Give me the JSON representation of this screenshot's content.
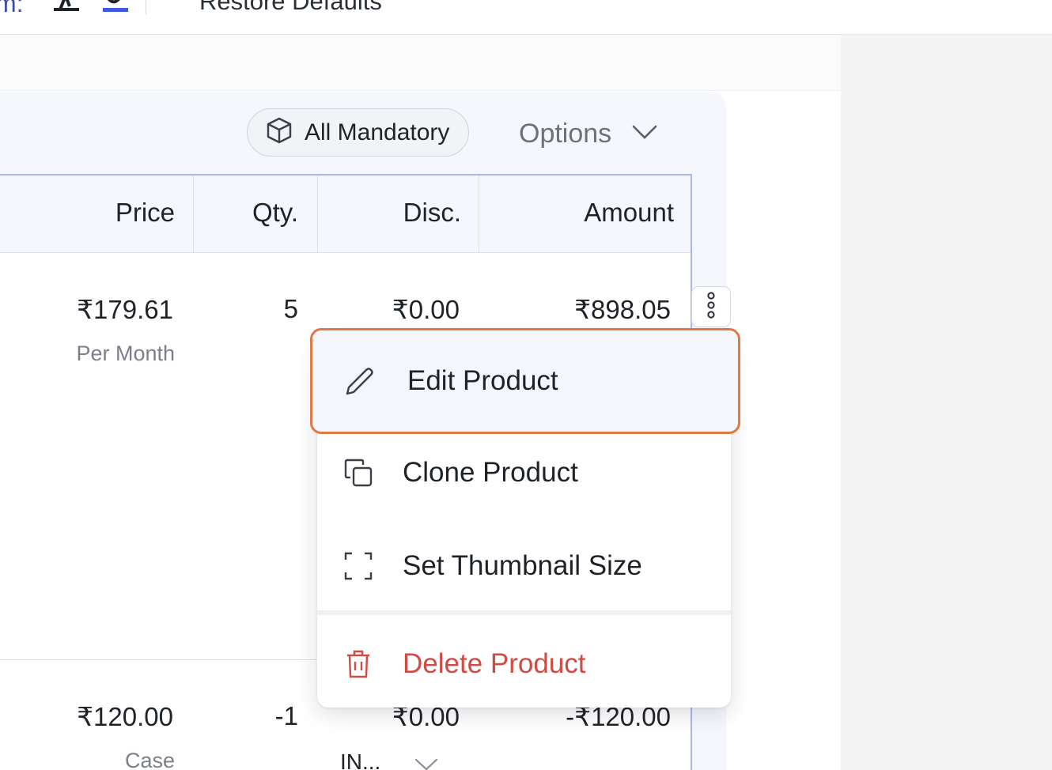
{
  "toolbar": {
    "partial_label": "m:",
    "restore_defaults": "Restore Defaults"
  },
  "section": {
    "mandatory_label": "All Mandatory",
    "options_label": "Options"
  },
  "table": {
    "columns": [
      "Price",
      "Qty.",
      "Disc.",
      "Amount"
    ],
    "rows": [
      {
        "price": "₹179.61",
        "price_unit": "Per Month",
        "qty": "5",
        "disc": "₹0.00",
        "amount": "₹898.05"
      },
      {
        "price": "₹120.00",
        "price_unit": "Case",
        "qty": "-1",
        "disc": "₹0.00",
        "amount": "-₹120.00",
        "tax_code": "IN..."
      }
    ]
  },
  "menu": {
    "items": [
      {
        "label": "Edit Product",
        "icon": "pencil-icon"
      },
      {
        "label": "Clone Product",
        "icon": "copy-icon"
      },
      {
        "label": "Set Thumbnail Size",
        "icon": "frame-icon"
      },
      {
        "label": "Delete Product",
        "icon": "trash-icon"
      }
    ]
  },
  "colors": {
    "accent_border": "#a8b8ee",
    "highlight_outline": "#e07a45",
    "danger": "#d14a43"
  }
}
